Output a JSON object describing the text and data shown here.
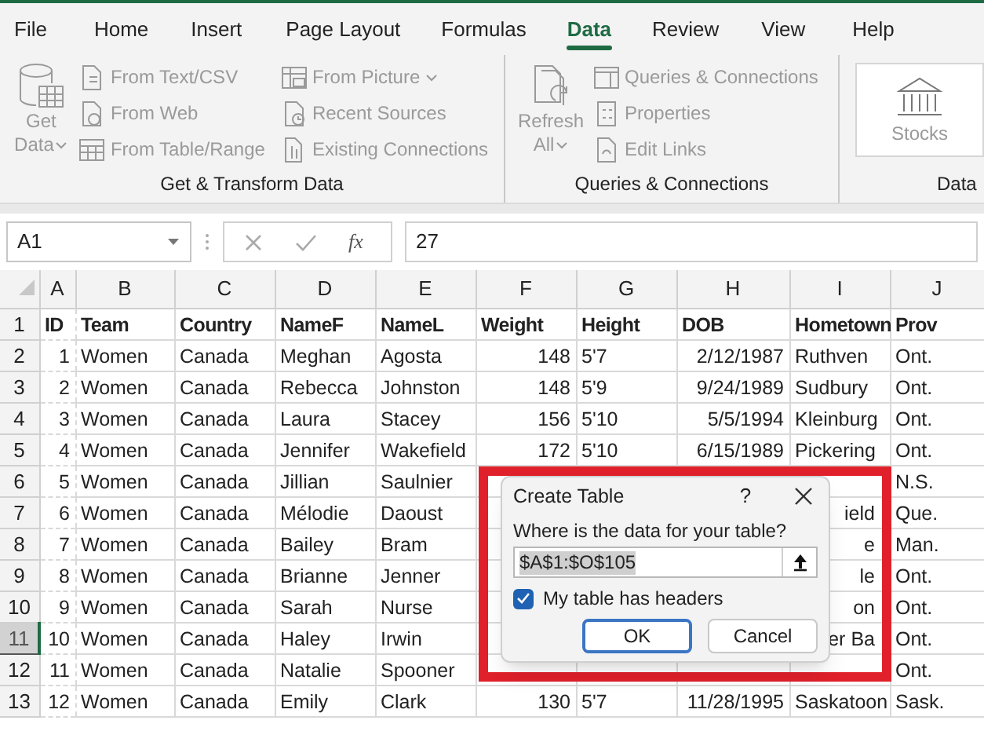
{
  "tabs": [
    {
      "label": "File",
      "selected": false
    },
    {
      "label": "Home",
      "selected": false
    },
    {
      "label": "Insert",
      "selected": false
    },
    {
      "label": "Page Layout",
      "selected": false
    },
    {
      "label": "Formulas",
      "selected": false
    },
    {
      "label": "Data",
      "selected": true
    },
    {
      "label": "Review",
      "selected": false
    },
    {
      "label": "View",
      "selected": false
    },
    {
      "label": "Help",
      "selected": false
    }
  ],
  "ribbon": {
    "groups": [
      {
        "label": "Get & Transform Data",
        "large": {
          "label": "Get Data",
          "dropdown": true,
          "disabled": true
        },
        "commands": [
          {
            "label": "From Text/CSV",
            "dropdown": false,
            "disabled": true
          },
          {
            "label": "From Web",
            "dropdown": false,
            "disabled": true
          },
          {
            "label": "From Table/Range",
            "dropdown": false,
            "disabled": true
          },
          {
            "label": "From Picture",
            "dropdown": true,
            "disabled": true
          },
          {
            "label": "Recent Sources",
            "dropdown": false,
            "disabled": true
          },
          {
            "label": "Existing Connections",
            "dropdown": false,
            "disabled": true
          }
        ]
      },
      {
        "label": "Queries & Connections",
        "large": {
          "label": "Refresh All",
          "dropdown": true,
          "disabled": true
        },
        "commands": [
          {
            "label": "Queries & Connections",
            "dropdown": false,
            "disabled": true
          },
          {
            "label": "Properties",
            "dropdown": false,
            "disabled": true
          },
          {
            "label": "Edit Links",
            "dropdown": false,
            "disabled": true
          }
        ]
      },
      {
        "label": "Data",
        "large": {
          "label": "Stocks",
          "dropdown": false,
          "disabled": true
        }
      }
    ]
  },
  "formula_bar": {
    "name_box": "A1",
    "function_label": "fx",
    "formula": "27"
  },
  "sheet": {
    "columns": [
      {
        "letter": "A",
        "right_aligned": true
      },
      {
        "letter": "B",
        "right_aligned": false
      },
      {
        "letter": "C",
        "right_aligned": false
      },
      {
        "letter": "D",
        "right_aligned": false
      },
      {
        "letter": "E",
        "right_aligned": false
      },
      {
        "letter": "F",
        "right_aligned": true
      },
      {
        "letter": "G",
        "right_aligned": false
      },
      {
        "letter": "H",
        "right_aligned": true
      },
      {
        "letter": "I",
        "right_aligned": false
      },
      {
        "letter": "J",
        "right_aligned": false
      }
    ],
    "rows": [
      {
        "number": "1",
        "selected": false,
        "header": true,
        "cells": [
          "ID",
          "Team",
          "Country",
          "NameF",
          "NameL",
          "Weight",
          "Height",
          "DOB",
          "Hometown",
          "Prov"
        ]
      },
      {
        "number": "2",
        "selected": false,
        "header": false,
        "cells": [
          "1",
          "Women",
          "Canada",
          "Meghan",
          "Agosta",
          "148",
          "5'7",
          "2/12/1987",
          "Ruthven",
          "Ont."
        ]
      },
      {
        "number": "3",
        "selected": false,
        "header": false,
        "cells": [
          "2",
          "Women",
          "Canada",
          "Rebecca",
          "Johnston",
          "148",
          "5'9",
          "9/24/1989",
          "Sudbury",
          "Ont."
        ]
      },
      {
        "number": "4",
        "selected": false,
        "header": false,
        "cells": [
          "3",
          "Women",
          "Canada",
          "Laura",
          "Stacey",
          "156",
          "5'10",
          "5/5/1994",
          "Kleinburg",
          "Ont."
        ]
      },
      {
        "number": "5",
        "selected": false,
        "header": false,
        "cells": [
          "4",
          "Women",
          "Canada",
          "Jennifer",
          "Wakefield",
          "172",
          "5'10",
          "6/15/1989",
          "Pickering",
          "Ont."
        ]
      },
      {
        "number": "6",
        "selected": false,
        "header": false,
        "cells": [
          "5",
          "Women",
          "Canada",
          "Jillian",
          "Saulnier",
          null,
          null,
          null,
          null,
          "N.S."
        ]
      },
      {
        "number": "7",
        "selected": false,
        "header": false,
        "cells": [
          "6",
          "Women",
          "Canada",
          "Mélodie",
          "Daoust",
          null,
          null,
          null,
          {
            "text": "ield",
            "covered": true
          },
          "Que."
        ]
      },
      {
        "number": "8",
        "selected": false,
        "header": false,
        "cells": [
          "7",
          "Women",
          "Canada",
          "Bailey",
          "Bram",
          null,
          null,
          null,
          {
            "text": "e",
            "covered": true
          },
          "Man."
        ]
      },
      {
        "number": "9",
        "selected": false,
        "header": false,
        "cells": [
          "8",
          "Women",
          "Canada",
          "Brianne",
          "Jenner",
          null,
          null,
          null,
          {
            "text": "le",
            "covered": true
          },
          "Ont."
        ]
      },
      {
        "number": "10",
        "selected": false,
        "header": false,
        "cells": [
          "9",
          "Women",
          "Canada",
          "Sarah",
          "Nurse",
          null,
          null,
          null,
          {
            "text": "on",
            "covered": true
          },
          "Ont."
        ]
      },
      {
        "number": "11",
        "selected": true,
        "header": false,
        "cells": [
          "10",
          "Women",
          "Canada",
          "Haley",
          "Irwin",
          null,
          null,
          null,
          {
            "text": "er Ba",
            "covered": true
          },
          "Ont."
        ]
      },
      {
        "number": "12",
        "selected": false,
        "header": false,
        "cells": [
          "11",
          "Women",
          "Canada",
          "Natalie",
          "Spooner",
          null,
          null,
          null,
          null,
          "Ont."
        ]
      },
      {
        "number": "13",
        "selected": false,
        "header": false,
        "cells": [
          "12",
          "Women",
          "Canada",
          "Emily",
          "Clark",
          "130",
          "5'7",
          "11/28/1995",
          "Saskatoon",
          "Sask."
        ]
      }
    ]
  },
  "dialog": {
    "title": "Create Table",
    "help": "?",
    "prompt": "Where is the data for your table?",
    "range": "$A$1:$O$105",
    "range_selected": true,
    "checkbox": {
      "label": "My table has headers",
      "checked": true
    },
    "buttons": [
      {
        "label": "OK",
        "default": true
      },
      {
        "label": "Cancel",
        "default": false
      }
    ],
    "highlighted": true
  }
}
